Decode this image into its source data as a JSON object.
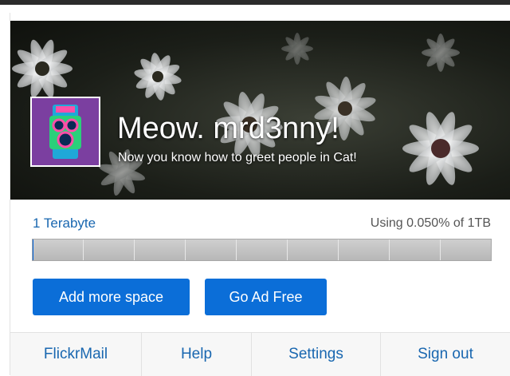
{
  "profile": {
    "greeting": "Meow. mrd3nny!",
    "subtitle": "Now you know how to greet people in Cat!",
    "avatar_icon": "camera-icon",
    "avatar_color": "#7b3fa0"
  },
  "storage": {
    "label": "1 Terabyte",
    "usage_text": "Using 0.050% of 1TB",
    "used_fraction": 0.0005,
    "meter_color": "#b7b7b7",
    "fill_color": "#0063dc"
  },
  "actions": {
    "add_space_label": "Add more space",
    "ad_free_label": "Go Ad Free",
    "accent": "#0b6ed8"
  },
  "footer": {
    "links": [
      "FlickrMail",
      "Help",
      "Settings",
      "Sign out"
    ],
    "link_color": "#1967b0"
  }
}
